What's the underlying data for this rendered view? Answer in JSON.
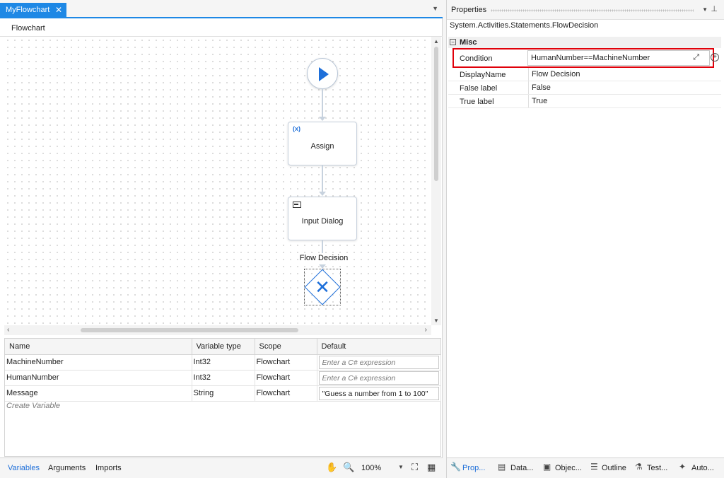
{
  "tabs": {
    "document_tab": "MyFlowchart",
    "close_glyph": "✕"
  },
  "breadcrumb": "Flowchart",
  "flowchart": {
    "nodes": [
      {
        "label": "",
        "icon": "play-icon"
      },
      {
        "label": "Assign",
        "icon": "assign-icon",
        "icon_text": "(x)"
      },
      {
        "label": "Input Dialog",
        "icon": "dialog-icon"
      }
    ],
    "decision": {
      "label": "Flow Decision",
      "icon": "close-icon",
      "glyph": "✕"
    }
  },
  "variables": {
    "headers": [
      "Name",
      "Variable type",
      "Scope",
      "Default"
    ],
    "rows": [
      {
        "name": "MachineNumber",
        "type": "Int32",
        "scope": "Flowchart",
        "default": "Enter a C# expression",
        "is_placeholder": true
      },
      {
        "name": "HumanNumber",
        "type": "Int32",
        "scope": "Flowchart",
        "default": "Enter a C# expression",
        "is_placeholder": true
      },
      {
        "name": "Message",
        "type": "String",
        "scope": "Flowchart",
        "default": "\"Guess a number from 1 to 100\"",
        "is_placeholder": false
      }
    ],
    "create_variable": "Create Variable"
  },
  "bottom_tabs": {
    "variables": "Variables",
    "arguments": "Arguments",
    "imports": "Imports"
  },
  "zoom": "100%",
  "properties": {
    "title": "Properties",
    "type_name": "System.Activities.Statements.FlowDecision",
    "category": "Misc",
    "collapse_glyph": "−",
    "rows": [
      {
        "name": "Condition",
        "value": "HumanNumber==MachineNumber"
      },
      {
        "name": "DisplayName",
        "value": "Flow Decision"
      },
      {
        "name": "False label",
        "value": "False"
      },
      {
        "name": "True label",
        "value": "True"
      }
    ]
  },
  "right_bottom_tabs": [
    "Prop...",
    "Data...",
    "Objec...",
    "Outline",
    "Test...",
    "Auto..."
  ],
  "colors": {
    "accent": "#1e88e5",
    "highlight_border": "#e0000a",
    "decision": "#1e6fd9"
  }
}
